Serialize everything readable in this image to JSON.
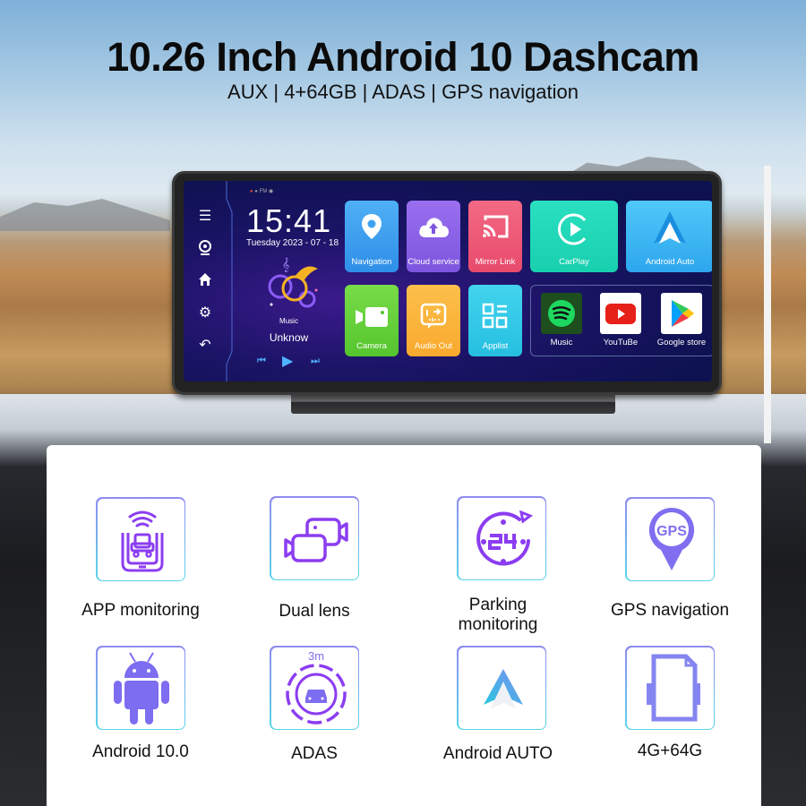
{
  "header": {
    "title": "10.26 Inch Android 10 Dashcam",
    "subtitle": "AUX | 4+64GB | ADAS | GPS navigation"
  },
  "device_screen": {
    "status_icons": [
      "wifi-icon",
      "record-dot-icon",
      "fm-icon",
      "gamepad-icon"
    ],
    "status_fm": "FM",
    "sidebar": [
      {
        "icon": "menu-icon"
      },
      {
        "icon": "webcam-icon"
      },
      {
        "icon": "home-icon"
      },
      {
        "icon": "gear-icon"
      },
      {
        "icon": "back-icon"
      }
    ],
    "clock": {
      "time": "15:41",
      "date": "Tuesday  2023 - 07 - 18"
    },
    "music": {
      "label": "Music",
      "track": "Unknow"
    },
    "tiles": [
      {
        "label": "Navigation",
        "icon": "location-pin-icon",
        "color": "#3da2f2"
      },
      {
        "label": "Cloud service",
        "icon": "cloud-upload-icon",
        "color": "#8a63e6"
      },
      {
        "label": "Mirror Link",
        "icon": "cast-icon",
        "color": "#ee5a78"
      },
      {
        "label": "CarPlay",
        "icon": "carplay-icon",
        "color": "#1fd8b4"
      },
      {
        "label": "Android Auto",
        "icon": "android-auto-icon",
        "color": "#3fb6f2"
      },
      {
        "label": "Camera",
        "icon": "video-camera-icon",
        "color": "#66d33a"
      },
      {
        "label": "Audio Out",
        "icon": "audio-out-icon",
        "color": "#fbb33a"
      },
      {
        "label": "Applist",
        "icon": "app-grid-icon",
        "color": "#33c9e6"
      }
    ],
    "apps": [
      {
        "label": "Music",
        "icon": "spotify-icon"
      },
      {
        "label": "YouTuBe",
        "icon": "youtube-icon"
      },
      {
        "label": "Google store",
        "icon": "google-play-icon"
      }
    ]
  },
  "features": [
    {
      "label": "APP monitoring",
      "icon": "phone-car-monitor-icon"
    },
    {
      "label": "Dual lens",
      "icon": "dual-camera-icon"
    },
    {
      "label": "Parking monitoring",
      "icon": "24h-clock-icon"
    },
    {
      "label": "GPS navigation",
      "icon": "gps-pin-icon",
      "icon_text": "GPS"
    },
    {
      "label": "Android 10.0",
      "icon": "android-robot-icon"
    },
    {
      "label": "ADAS",
      "icon": "adas-car-radar-icon",
      "icon_text": "3m"
    },
    {
      "label": "Android AUTO",
      "icon": "android-auto-logo-icon"
    },
    {
      "label": "4G+64G",
      "icon": "sd-card-icon"
    }
  ],
  "colors": {
    "accent_purple": "#7b3fe4",
    "accent_indigo": "#7f7ff2",
    "border_cyan": "#5ad6e8"
  }
}
